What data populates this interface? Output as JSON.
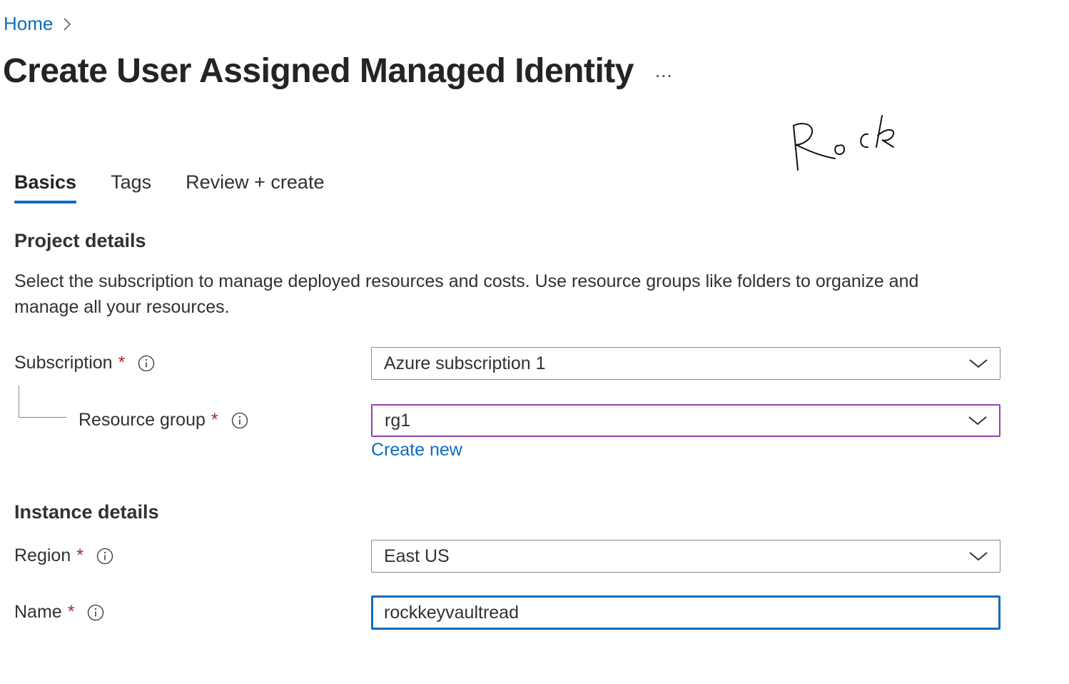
{
  "breadcrumb": {
    "home": "Home"
  },
  "page": {
    "title": "Create User Assigned Managed Identity",
    "more": "..."
  },
  "signature": {
    "text": "Rock"
  },
  "tabs": [
    {
      "label": "Basics",
      "active": true
    },
    {
      "label": "Tags",
      "active": false
    },
    {
      "label": "Review + create",
      "active": false
    }
  ],
  "project": {
    "heading": "Project details",
    "description": "Select the subscription to manage deployed resources and costs. Use resource groups like folders to organize and manage all your resources.",
    "subscription": {
      "label": "Subscription",
      "required": "*",
      "value": "Azure subscription 1"
    },
    "resource_group": {
      "label": "Resource group",
      "required": "*",
      "value": "rg1",
      "create_new": "Create new"
    }
  },
  "instance": {
    "heading": "Instance details",
    "region": {
      "label": "Region",
      "required": "*",
      "value": "East US"
    },
    "name": {
      "label": "Name",
      "required": "*",
      "value": "rockkeyvaultread"
    }
  },
  "colors": {
    "accent": "#0f6cbd",
    "required": "#a4262c",
    "rg_border": "#8e44ad"
  },
  "icons": {
    "info": "info-icon",
    "dropdown": "chevron-down-icon",
    "breadcrumb_separator": "chevron-right-icon"
  }
}
